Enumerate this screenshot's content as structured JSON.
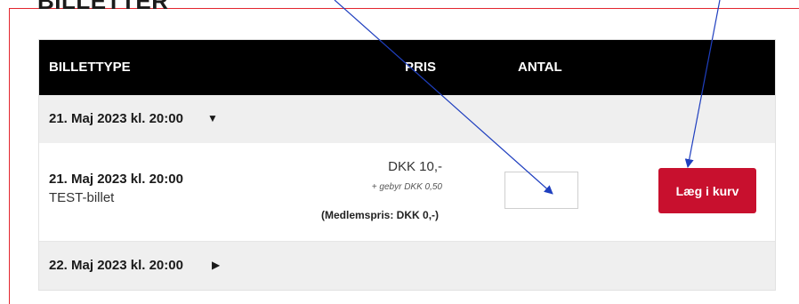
{
  "section_heading": "BILLETTER",
  "table": {
    "header": {
      "type": "BILLETTYPE",
      "price": "PRIS",
      "quantity": "ANTAL"
    },
    "groups": [
      {
        "date_label": "21. Maj 2023 kl. 20:00",
        "toggle_icon": "triangle-down-icon",
        "expanded": true,
        "ticket": {
          "date": "21. Maj 2023 kl. 20:00",
          "name": "TEST-billet",
          "price": "DKK 10,-",
          "fee": "+ gebyr DKK 0,50",
          "member_price": "(Medlemspris: DKK 0,-)",
          "quantity_value": "",
          "add_button": "Læg i kurv"
        }
      },
      {
        "date_label": "22. Maj 2023 kl. 20:00",
        "toggle_icon": "triangle-right-icon",
        "expanded": false
      }
    ]
  },
  "colors": {
    "frame": "#e3262e",
    "header_bg": "#000000",
    "button_bg": "#c8102e",
    "annotation_arrow": "#1f3fbf"
  }
}
